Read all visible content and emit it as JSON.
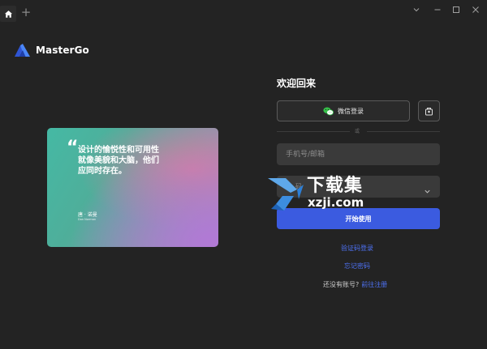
{
  "titlebar": {
    "new_tab_label": "+",
    "home_icon": "home-icon",
    "controls": [
      "chevron-down-icon",
      "minimize-icon",
      "maximize-icon",
      "close-icon"
    ]
  },
  "app": {
    "name": "MasterGo",
    "brand_color": "#3b5be0"
  },
  "quote_card": {
    "mark": "“",
    "text": "设计的愉悦性和可用性就像美貌和大脑，他们应同时存在。",
    "author": "唐 · 诺曼",
    "author_en": "Don Norman"
  },
  "login": {
    "welcome": "欢迎回来",
    "wechat_label": "微信登录",
    "or_text": "或",
    "phone_placeholder": "手机号/邮箱",
    "password_prefix": "码",
    "start_label": "开始使用",
    "code_login": "验证码登录",
    "forgot_password": "忘记密码",
    "no_account": "还没有账号?",
    "register": "前往注册"
  },
  "watermark": {
    "title": "下载集",
    "domain": "xzji.com"
  }
}
